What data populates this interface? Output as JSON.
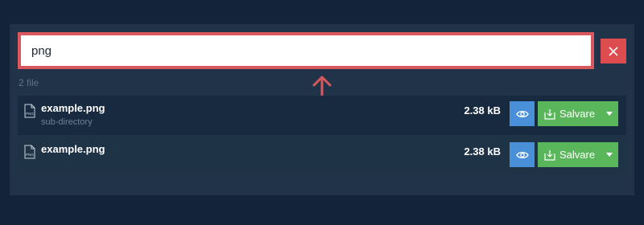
{
  "search": {
    "value": "png",
    "clear_icon": "close-icon"
  },
  "result_count": "2 file",
  "files": [
    {
      "name": "example.png",
      "subdirectory": "sub-directory",
      "size": "2.38 kB",
      "icon_label": "PNG",
      "view_icon": "eye-icon",
      "save_label": "Salvare",
      "save_icon": "download-icon",
      "menu_icon": "caret-down-icon"
    },
    {
      "name": "example.png",
      "subdirectory": "",
      "size": "2.38 kB",
      "icon_label": "PNG",
      "view_icon": "eye-icon",
      "save_label": "Salvare",
      "save_icon": "download-icon",
      "menu_icon": "caret-down-icon"
    }
  ],
  "colors": {
    "background": "#12233a",
    "panel": "#203348",
    "search_border": "#d9585d",
    "clear_button": "#dd4d4f",
    "view_button": "#4a90d9",
    "save_button": "#59b65a",
    "annotation_arrow": "#d9585d"
  }
}
